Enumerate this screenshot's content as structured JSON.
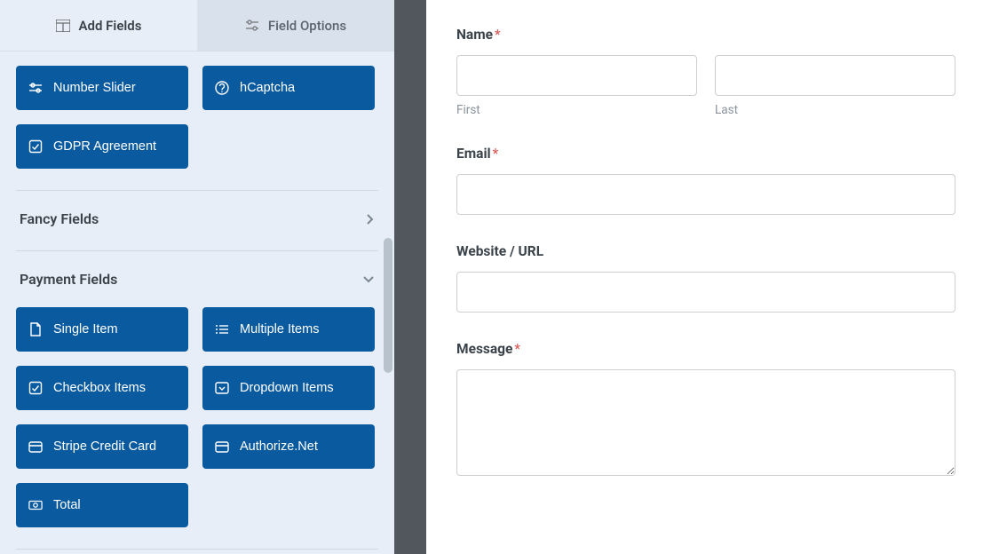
{
  "tabs": {
    "add_fields": "Add Fields",
    "field_options": "Field Options"
  },
  "top_fields": [
    {
      "icon": "sliders",
      "label": "Number Slider"
    },
    {
      "icon": "question",
      "label": "hCaptcha"
    },
    {
      "icon": "check",
      "label": "GDPR Agreement"
    }
  ],
  "sections": {
    "fancy": {
      "title": "Fancy Fields"
    },
    "payment": {
      "title": "Payment Fields",
      "items": [
        {
          "icon": "file",
          "label": "Single Item"
        },
        {
          "icon": "list",
          "label": "Multiple Items"
        },
        {
          "icon": "check",
          "label": "Checkbox Items"
        },
        {
          "icon": "dropdown",
          "label": "Dropdown Items"
        },
        {
          "icon": "card",
          "label": "Stripe Credit Card"
        },
        {
          "icon": "card",
          "label": "Authorize.Net"
        },
        {
          "icon": "money",
          "label": "Total"
        }
      ]
    }
  },
  "form": {
    "name": {
      "label": "Name",
      "first_sub": "First",
      "last_sub": "Last"
    },
    "email": {
      "label": "Email"
    },
    "website": {
      "label": "Website / URL"
    },
    "message": {
      "label": "Message"
    }
  }
}
